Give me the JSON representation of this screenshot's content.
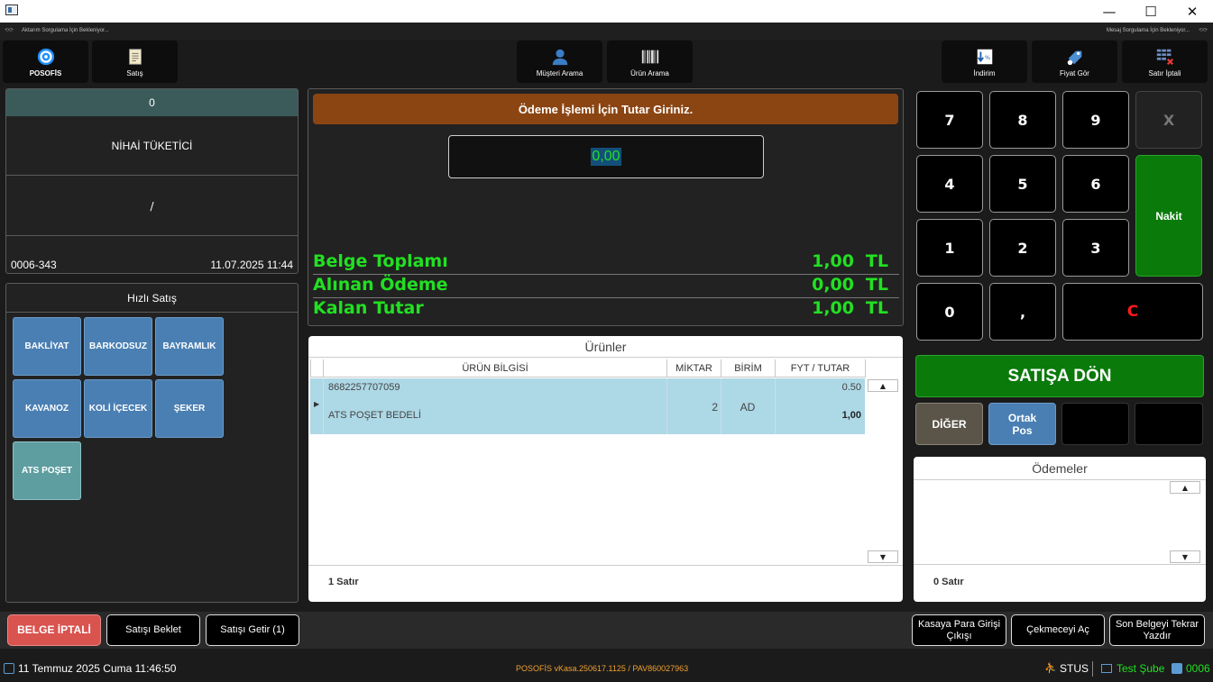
{
  "window": {
    "minimize": "—",
    "maximize": "☐",
    "close": "✕"
  },
  "status": {
    "left": "Aktarım Sorgulama İçin Bekleniyor...",
    "right": "Mesaj Sorgulama İçin Bekleniyor..."
  },
  "toolbar": {
    "posofis": "POSOFİS",
    "satis": "Satış",
    "musteri_arama": "Müşteri Arama",
    "urun_arama": "Ürün Arama",
    "indirim": "İndirim",
    "fiyat_gor": "Fiyat Gör",
    "satir_iptali": "Satır İptali"
  },
  "customer": {
    "header": "0",
    "name": "NİHAİ TÜKETİCİ",
    "address": "/",
    "doc_no": "0006-343",
    "datetime": "11.07.2025 11:44"
  },
  "quick_sale": {
    "title": "Hızlı Satış",
    "items": [
      "BAKLİYAT",
      "BARKODSUZ",
      "BAYRAMLIK",
      "KAVANOZ",
      "KOLİ İÇECEK",
      "ŞEKER",
      "ATS POŞET"
    ]
  },
  "payment": {
    "banner": "Ödeme İşlemi İçin Tutar Giriniz.",
    "input_value": "0,00",
    "rows": [
      {
        "label": "Belge Toplamı",
        "value": "1,00",
        "currency": "TL"
      },
      {
        "label": "Alınan Ödeme",
        "value": "0,00",
        "currency": "TL"
      },
      {
        "label": "Kalan Tutar",
        "value": "1,00",
        "currency": "TL"
      }
    ]
  },
  "products": {
    "title": "Ürünler",
    "columns": [
      "ÜRÜN BİLGİSİ",
      "MİKTAR",
      "BİRİM",
      "FYT / TUTAR"
    ],
    "row": {
      "barcode": "8682257707059",
      "name": "ATS POŞET BEDELİ",
      "quantity": "2",
      "unit": "AD",
      "price": "0.50",
      "total": "1,00"
    },
    "count": "1 Satır"
  },
  "keypad": {
    "keys": [
      "7",
      "8",
      "9",
      "X",
      "4",
      "5",
      "6",
      "1",
      "2",
      "3",
      "0",
      ","
    ],
    "clear": "C",
    "nakit": "Nakit",
    "satisa_don": "SATIŞA DÖN",
    "diger": "DİĞER",
    "ortak_pos": "Ortak Pos"
  },
  "payments": {
    "title": "Ödemeler",
    "count": "0 Satır"
  },
  "bottom": {
    "belge_iptali": "BELGE İPTALİ",
    "satisi_beklet": "Satışı Beklet",
    "satisi_getir": "Satışı Getir (1)",
    "kasaya_para": "Kasaya Para Girişi Çıkışı",
    "cekmeceyi_ac": "Çekmeceyi Aç",
    "son_belge": "Son Belgeyi Tekrar Yazdır"
  },
  "footer": {
    "date": "11 Temmuz 2025 Cuma 11:46:50",
    "version": "POSOFİS vKasa.250617.1125 / PAV860027963",
    "user": "STUS",
    "branch": "Test Şube",
    "register": "0006"
  },
  "colors": {
    "accent_green": "#22e022",
    "banner_brown": "#8b4513",
    "nakit_green": "#0a7a0a",
    "quick_blue": "#4a7fb3",
    "row_blue": "#add8e6",
    "belge_red": "#d9534f"
  }
}
